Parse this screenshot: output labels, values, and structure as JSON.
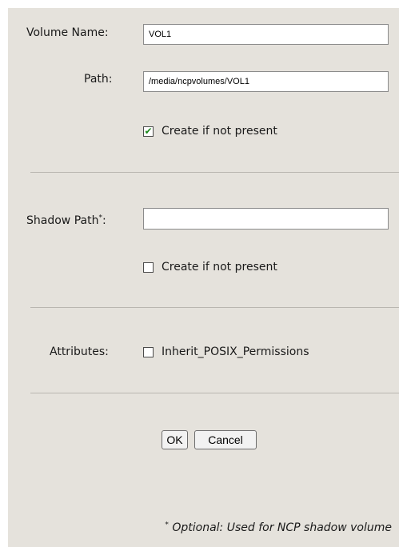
{
  "form": {
    "volume_name": {
      "label": "Volume Name:",
      "value": "VOL1"
    },
    "path": {
      "label": "Path:",
      "value": "/media/ncpvolumes/VOL1"
    },
    "path_create": {
      "label": "Create if not present",
      "checked": true
    },
    "shadow_path": {
      "label": "Shadow Path",
      "label_mark": "*",
      "label_suffix": ":",
      "value": ""
    },
    "shadow_create": {
      "label": "Create if not present",
      "checked": false
    },
    "attributes": {
      "label": "Attributes:"
    },
    "inherit_posix": {
      "label": "Inherit_POSIX_Permissions",
      "checked": false
    }
  },
  "buttons": {
    "ok": "OK",
    "cancel": "Cancel"
  },
  "footnote": {
    "mark": "*",
    "text": "Optional: Used for NCP shadow volume"
  },
  "icons": {
    "checkmark": "✔"
  },
  "colors": {
    "panel_bg": "#e5e2dc",
    "check_green": "#1e8a1e"
  }
}
